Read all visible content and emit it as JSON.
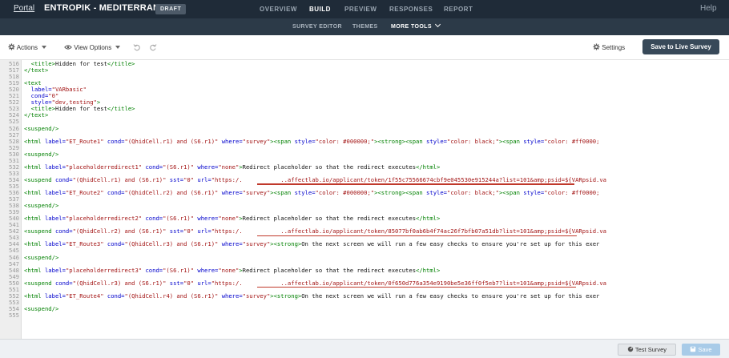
{
  "topbar": {
    "portal": "Portal",
    "project_title": "ENTROPIK - MEDITERRANE...",
    "badge": "DRAFT",
    "nav": [
      "OVERVIEW",
      "BUILD",
      "PREVIEW",
      "RESPONSES",
      "REPORT"
    ],
    "active_nav": "BUILD",
    "help": "Help"
  },
  "subbar": {
    "items": [
      "SURVEY EDITOR",
      "THEMES",
      "MORE TOOLS"
    ],
    "active": "MORE TOOLS"
  },
  "toolbar": {
    "actions": "Actions",
    "view_options": "View Options",
    "undo_icon": "undo-icon",
    "redo_icon": "redo-icon",
    "settings": "Settings",
    "save_live": "Save to Live Survey"
  },
  "footer": {
    "test_survey": "Test Survey",
    "save": "Save"
  },
  "colors": {
    "topbar": "#1f2b38",
    "subbar": "#2c3a48",
    "primary_button": "#384959",
    "tag": "#008000",
    "attr": "#0000cc",
    "string": "#a31515",
    "underline": "#c0392b"
  },
  "code_lines": [
    {
      "n": "516",
      "html": "  <span class='tag'>&lt;title&gt;</span><span class='txt'>Hidden for test</span><span class='tag'>&lt;/title&gt;</span>"
    },
    {
      "n": "517",
      "html": "<span class='tag'>&lt;/text&gt;</span>"
    },
    {
      "n": "518",
      "html": ""
    },
    {
      "n": "519",
      "html": "<span class='tag'>&lt;text</span>"
    },
    {
      "n": "520",
      "html": "  <span class='attr'>label=</span><span class='str'>\"VARbasic\"</span>"
    },
    {
      "n": "521",
      "html": "  <span class='attr'>cond=</span><span class='str'>\"0\"</span>"
    },
    {
      "n": "522",
      "html": "  <span class='attr'>style=</span><span class='str'>\"dev,testing\"</span><span class='tag'>&gt;</span>"
    },
    {
      "n": "523",
      "html": "  <span class='tag'>&lt;title&gt;</span><span class='txt'>Hidden for test</span><span class='tag'>&lt;/title&gt;</span>"
    },
    {
      "n": "524",
      "html": "<span class='tag'>&lt;/text&gt;</span>"
    },
    {
      "n": "525",
      "html": ""
    },
    {
      "n": "526",
      "html": "<span class='tag'>&lt;suspend/&gt;</span>"
    },
    {
      "n": "527",
      "html": ""
    },
    {
      "n": "528",
      "html": "<span class='tag'>&lt;html</span> <span class='attr'>label=</span><span class='str'>\"ET_Route1\"</span> <span class='attr'>cond=</span><span class='str'>\"(QhidCell.r1) and (S6.r1)\"</span> <span class='attr'>where=</span><span class='str'>\"survey\"</span><span class='tag'>&gt;&lt;span</span> <span class='attr'>style=</span><span class='str'>\"color: #000000;\"</span><span class='tag'>&gt;&lt;strong&gt;&lt;span</span> <span class='attr'>style=</span><span class='str'>\"color: black;\"</span><span class='tag'>&gt;&lt;span</span> <span class='attr'>style=</span><span class='str'>\"color: #ff0000;</span>"
    },
    {
      "n": "529",
      "html": ""
    },
    {
      "n": "530",
      "html": "<span class='tag'>&lt;suspend/&gt;</span>"
    },
    {
      "n": "531",
      "html": ""
    },
    {
      "n": "532",
      "html": "<span class='tag'>&lt;html</span> <span class='attr'>label=</span><span class='str'>\"placeholderredirect1\"</span> <span class='attr'>cond=</span><span class='str'>\"(S6.r1)\"</span> <span class='attr'>where=</span><span class='str'>\"none\"</span><span class='tag'>&gt;</span><span class='txt'>Redirect placeholder so that the redirect executes</span><span class='tag'>&lt;/html&gt;</span>"
    },
    {
      "n": "533",
      "html": ""
    },
    {
      "n": "534",
      "html": "<span class='tag'>&lt;suspend</span> <span class='attr'>cond=</span><span class='str'>\"(QhidCell.r1) and (S6.r1)\"</span> <span class='attr'>sst=</span><span class='str'>\"0\"</span> <span class='attr'>url=</span><span class='str'>\"https:/.           ..affectlab.io/applicant/token/1f55c75566674cbf9e045530e915244a?list=101&amp;amp;psid=${VARpsid.va</span>"
    },
    {
      "n": "535",
      "html": ""
    },
    {
      "n": "536",
      "html": "<span class='tag'>&lt;html</span> <span class='attr'>label=</span><span class='str'>\"ET_Route2\"</span> <span class='attr'>cond=</span><span class='str'>\"(QhidCell.r2) and (S6.r1)\"</span> <span class='attr'>where=</span><span class='str'>\"survey\"</span><span class='tag'>&gt;&lt;span</span> <span class='attr'>style=</span><span class='str'>\"color: #000000;\"</span><span class='tag'>&gt;&lt;strong&gt;&lt;span</span> <span class='attr'>style=</span><span class='str'>\"color: black;\"</span><span class='tag'>&gt;&lt;span</span> <span class='attr'>style=</span><span class='str'>\"color: #ff0000;</span>"
    },
    {
      "n": "537",
      "html": ""
    },
    {
      "n": "538",
      "html": "<span class='tag'>&lt;suspend/&gt;</span>"
    },
    {
      "n": "539",
      "html": ""
    },
    {
      "n": "540",
      "html": "<span class='tag'>&lt;html</span> <span class='attr'>label=</span><span class='str'>\"placeholderredirect2\"</span> <span class='attr'>cond=</span><span class='str'>\"(S6.r1)\"</span> <span class='attr'>where=</span><span class='str'>\"none\"</span><span class='tag'>&gt;</span><span class='txt'>Redirect placeholder so that the redirect executes</span><span class='tag'>&lt;/html&gt;</span>"
    },
    {
      "n": "541",
      "html": ""
    },
    {
      "n": "542",
      "html": "<span class='tag'>&lt;suspend</span> <span class='attr'>cond=</span><span class='str'>\"(QhidCell.r2) and (S6.r1)\"</span> <span class='attr'>sst=</span><span class='str'>\"0\"</span> <span class='attr'>url=</span><span class='str'>\"https:/.           ..affectlab.io/applicant/token/85077bf0ab6b4f74ac26f7bfb07a51db?list=101&amp;amp;psid=${VARpsid.va</span>"
    },
    {
      "n": "543",
      "html": ""
    },
    {
      "n": "544",
      "html": "<span class='tag'>&lt;html</span> <span class='attr'>label=</span><span class='str'>\"ET_Route3\"</span> <span class='attr'>cond=</span><span class='str'>\"(QhidCell.r3) and (S6.r1)\"</span> <span class='attr'>where=</span><span class='str'>\"survey\"</span><span class='tag'>&gt;&lt;strong&gt;</span><span class='txt'>On the next screen we will run a few easy checks to ensure you're set up for this exer</span>"
    },
    {
      "n": "545",
      "html": ""
    },
    {
      "n": "546",
      "html": "<span class='tag'>&lt;suspend/&gt;</span>"
    },
    {
      "n": "547",
      "html": ""
    },
    {
      "n": "548",
      "html": "<span class='tag'>&lt;html</span> <span class='attr'>label=</span><span class='str'>\"placeholderredirect3\"</span> <span class='attr'>cond=</span><span class='str'>\"(S6.r1)\"</span> <span class='attr'>where=</span><span class='str'>\"none\"</span><span class='tag'>&gt;</span><span class='txt'>Redirect placeholder so that the redirect executes</span><span class='tag'>&lt;/html&gt;</span>"
    },
    {
      "n": "549",
      "html": ""
    },
    {
      "n": "550",
      "html": "<span class='tag'>&lt;suspend</span> <span class='attr'>cond=</span><span class='str'>\"(QhidCell.r3) and (S6.r1)\"</span> <span class='attr'>sst=</span><span class='str'>\"0\"</span> <span class='attr'>url=</span><span class='str'>\"https:/.           ..affectlab.io/applicant/token/0f650d776a354e9190be5e36ff0f5eb7?list=101&amp;amp;psid=${VARpsid.va</span>"
    },
    {
      "n": "551",
      "html": ""
    },
    {
      "n": "552",
      "html": "<span class='tag'>&lt;html</span> <span class='attr'>label=</span><span class='str'>\"ET_Route4\"</span> <span class='attr'>cond=</span><span class='str'>\"(QhidCell.r4) and (S6.r1)\"</span> <span class='attr'>where=</span><span class='str'>\"survey\"</span><span class='tag'>&gt;&lt;strong&gt;</span><span class='txt'>On the next screen we will run a few easy checks to ensure you're set up for this exer</span>"
    },
    {
      "n": "553",
      "html": ""
    },
    {
      "n": "554",
      "html": "<span class='tag'>&lt;suspend/&gt;</span>"
    },
    {
      "n": "555",
      "html": ""
    }
  ]
}
